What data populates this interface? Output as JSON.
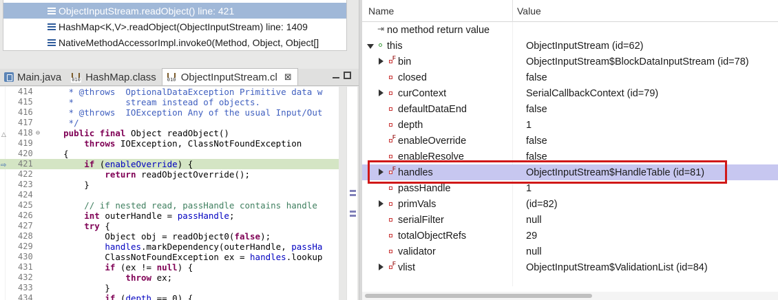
{
  "stack_frames": [
    {
      "label": "ObjectInputStream.readObject() line: 421",
      "selected": true
    },
    {
      "label": "HashMap<K,V>.readObject(ObjectInputStream) line: 1409",
      "selected": false
    },
    {
      "label": "NativeMethodAccessorImpl.invoke0(Method, Object, Object[]",
      "selected": false
    }
  ],
  "tabs": [
    {
      "label": "Main.java",
      "icon": "java-file-icon"
    },
    {
      "label": "HashMap.class",
      "icon": "class-file-icon"
    },
    {
      "label": "ObjectInputStream.cl",
      "icon": "class-file-icon",
      "active": true,
      "close": "⊠"
    }
  ],
  "code_lines": [
    {
      "num": "414",
      "html": "<span class=\"cm\">     * @throws  OptionalDataException Primitive data w</span>"
    },
    {
      "num": "415",
      "html": "<span class=\"cm\">     *          stream instead of objects.</span>"
    },
    {
      "num": "416",
      "html": "<span class=\"cm\">     * @throws  IOException Any of the usual Input/Out</span>"
    },
    {
      "num": "417",
      "html": "<span class=\"cm\">     */</span>"
    },
    {
      "num": "418",
      "html": "    <span class=\"kw\">public final</span> Object readObject()",
      "fold": true
    },
    {
      "num": "419",
      "html": "        <span class=\"kw\">throws</span> IOException, ClassNotFoundException"
    },
    {
      "num": "420",
      "html": "    {"
    },
    {
      "num": "421",
      "html": "        <span class=\"kw\">if</span> (<span class=\"fld\">enableOverride</span>) {",
      "current": true
    },
    {
      "num": "422",
      "html": "            <span class=\"kw\">return</span> readObjectOverride();"
    },
    {
      "num": "423",
      "html": "        }"
    },
    {
      "num": "424",
      "html": ""
    },
    {
      "num": "425",
      "html": "        <span class=\"lc\">// if nested read, passHandle contains handle</span>"
    },
    {
      "num": "426",
      "html": "        <span class=\"kw\">int</span> outerHandle = <span class=\"fld\">passHandle</span>;"
    },
    {
      "num": "427",
      "html": "        <span class=\"kw\">try</span> {"
    },
    {
      "num": "428",
      "html": "            Object obj = readObject0(<span class=\"kw\">false</span>);"
    },
    {
      "num": "429",
      "html": "            <span class=\"fld\">handles</span>.markDependency(outerHandle, <span class=\"fld\">passHa</span>"
    },
    {
      "num": "430",
      "html": "            ClassNotFoundException ex = <span class=\"fld\">handles</span>.lookup"
    },
    {
      "num": "431",
      "html": "            <span class=\"kw\">if</span> (ex != <span class=\"kw\">null</span>) {"
    },
    {
      "num": "432",
      "html": "                <span class=\"kw\">throw</span> ex;"
    },
    {
      "num": "433",
      "html": "            }"
    },
    {
      "num": "434",
      "html": "            <span class=\"kw\">if</span> (<span class=\"fld\">depth</span> == 0) {"
    }
  ],
  "variables_view": {
    "columns": {
      "name": "Name",
      "value": "Value"
    },
    "rows": [
      {
        "name": "no method return value",
        "value": "",
        "icon": "return-icon",
        "indent": 0,
        "expand": "none"
      },
      {
        "name": "this",
        "value": "ObjectInputStream  (id=62)",
        "icon": "local-var-icon",
        "indent": 0,
        "expand": "open"
      },
      {
        "name": "bin",
        "value": "ObjectInputStream$BlockDataInputStream  (id=78)",
        "icon": "final-field-icon",
        "indent": 1,
        "expand": "closed"
      },
      {
        "name": "closed",
        "value": "false",
        "icon": "field-icon",
        "indent": 1,
        "expand": "none"
      },
      {
        "name": "curContext",
        "value": "SerialCallbackContext  (id=79)",
        "icon": "field-icon",
        "indent": 1,
        "expand": "closed"
      },
      {
        "name": "defaultDataEnd",
        "value": "false",
        "icon": "field-icon",
        "indent": 1,
        "expand": "none"
      },
      {
        "name": "depth",
        "value": "1",
        "icon": "field-icon",
        "indent": 1,
        "expand": "none"
      },
      {
        "name": "enableOverride",
        "value": "false",
        "icon": "final-field-icon",
        "indent": 1,
        "expand": "none"
      },
      {
        "name": "enableResolve",
        "value": "false",
        "icon": "field-icon",
        "indent": 1,
        "expand": "none"
      },
      {
        "name": "handles",
        "value": "ObjectInputStream$HandleTable  (id=81)",
        "icon": "final-field-icon",
        "indent": 1,
        "expand": "closed",
        "highlight": true
      },
      {
        "name": "passHandle",
        "value": "1",
        "icon": "field-icon",
        "indent": 1,
        "expand": "none"
      },
      {
        "name": "primVals",
        "value": "(id=82)",
        "icon": "field-icon",
        "indent": 1,
        "expand": "closed"
      },
      {
        "name": "serialFilter",
        "value": "null",
        "icon": "field-icon",
        "indent": 1,
        "expand": "none"
      },
      {
        "name": "totalObjectRefs",
        "value": "29",
        "icon": "field-icon",
        "indent": 1,
        "expand": "none"
      },
      {
        "name": "validator",
        "value": "null",
        "icon": "field-icon",
        "indent": 1,
        "expand": "none"
      },
      {
        "name": "vlist",
        "value": "ObjectInputStream$ValidationList  (id=84)",
        "icon": "final-field-icon",
        "indent": 1,
        "expand": "closed"
      }
    ]
  },
  "colors": {
    "selection": "#a0b8d8",
    "highlight_row": "#c7c7f0",
    "callout_border": "#d01818",
    "current_line": "#d4e5c4"
  }
}
